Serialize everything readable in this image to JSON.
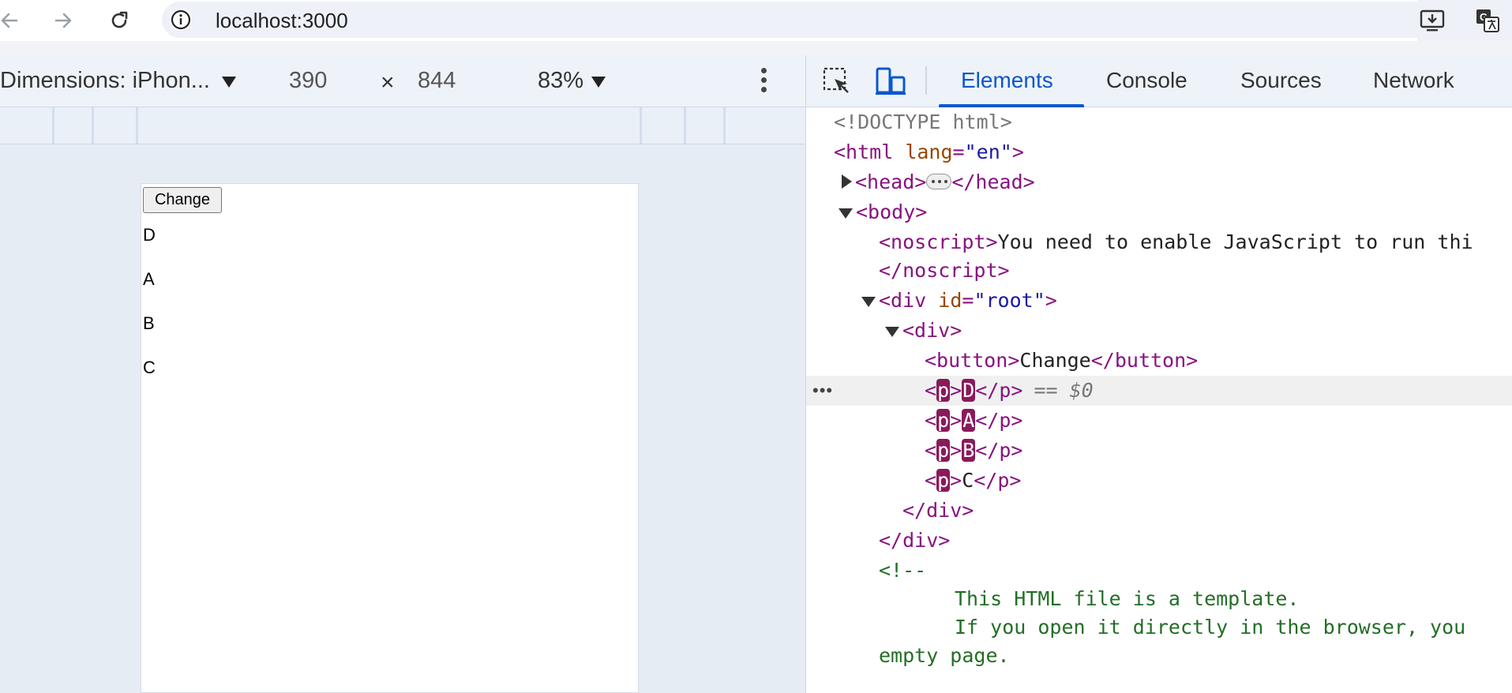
{
  "browser": {
    "url": "localhost:3000",
    "icons": [
      "back-arrow-icon",
      "forward-arrow-icon",
      "reload-icon",
      "site-info-icon",
      "install-app-icon",
      "translate-icon"
    ]
  },
  "device_toolbar": {
    "dimensions_label": "Dimensions: iPhon...",
    "width": "390",
    "times": "×",
    "height": "844",
    "zoom": "83%"
  },
  "viewport": {
    "button_label": "Change",
    "items": [
      "D",
      "A",
      "B",
      "C"
    ]
  },
  "devtools": {
    "tabs": [
      "Elements",
      "Console",
      "Sources",
      "Network"
    ],
    "active_tab": "Elements",
    "code": {
      "doctype": "<!DOCTYPE html>",
      "html_open": "<html ",
      "html_attr": "lang",
      "html_val": "\"en\"",
      "html_close": ">",
      "head_open": "<head>",
      "head_close": "</head>",
      "body_open": "<body>",
      "noscript_open": "<noscript>",
      "noscript_text": "You need to enable JavaScript to run thi",
      "noscript_close": "</noscript>",
      "div_root_open": "<div ",
      "div_root_attr": "id",
      "div_root_val": "\"root\"",
      "div_root_close": ">",
      "div_open": "<div>",
      "button_open": "<button>",
      "button_text": "Change",
      "button_close": "</button>",
      "p_lines": [
        {
          "text": "D",
          "selected": true
        },
        {
          "text": "A",
          "selected": false
        },
        {
          "text": "B",
          "selected": false
        },
        {
          "text": "C",
          "selected": false
        }
      ],
      "p_open_a": "<",
      "p_name": "p",
      "p_open_b": ">",
      "p_close": "</p>",
      "sel_suffix": "== $0",
      "div_close": "</div>",
      "comment_open": "<!--",
      "comment_line1": "This HTML file is a template.",
      "comment_line2": "If you open it directly in the browser, you",
      "comment_line3": "empty page."
    }
  }
}
